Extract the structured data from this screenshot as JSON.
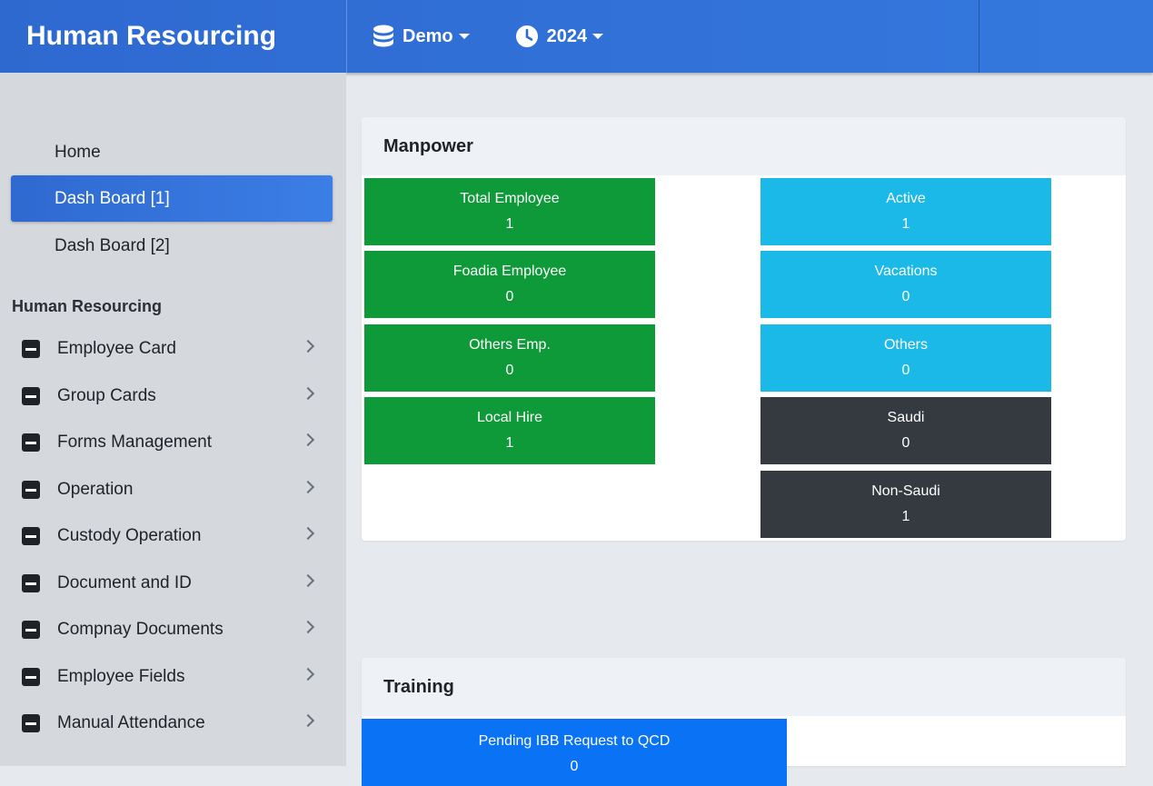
{
  "header": {
    "title": "Human Resourcing",
    "database_label": "Demo",
    "year_label": "2024"
  },
  "sidebar": {
    "top_items": [
      {
        "label": "Home",
        "active": false
      },
      {
        "label": "Dash Board [1]",
        "active": true
      },
      {
        "label": "Dash Board [2]",
        "active": false
      }
    ],
    "section_heading": "Human Resourcing",
    "items": [
      {
        "label": "Employee Card"
      },
      {
        "label": "Group Cards"
      },
      {
        "label": "Forms Management"
      },
      {
        "label": "Operation"
      },
      {
        "label": "Custody Operation"
      },
      {
        "label": "Document and ID"
      },
      {
        "label": "Compnay Documents"
      },
      {
        "label": "Employee Fields"
      },
      {
        "label": "Manual Attendance"
      }
    ]
  },
  "manpower": {
    "title": "Manpower",
    "left_tiles": [
      {
        "label": "Total Employee",
        "value": "1",
        "color": "#0f9a3a"
      },
      {
        "label": "Foadia Employee",
        "value": "0",
        "color": "#0f9a3a"
      },
      {
        "label": "Others Emp.",
        "value": "0",
        "color": "#0f9a3a"
      },
      {
        "label": "Local Hire",
        "value": "1",
        "color": "#0f9a3a"
      }
    ],
    "right_tiles": [
      {
        "label": "Active",
        "value": "1",
        "color": "#1bb9e8"
      },
      {
        "label": "Vacations",
        "value": "0",
        "color": "#1bb9e8"
      },
      {
        "label": "Others",
        "value": "0",
        "color": "#1bb9e8"
      },
      {
        "label": "Saudi",
        "value": "0",
        "color": "#343a40"
      },
      {
        "label": "Non-Saudi",
        "value": "1",
        "color": "#343a40"
      }
    ]
  },
  "training": {
    "title": "Training",
    "tiles": [
      {
        "label": "Pending IBB Request to QCD",
        "value": "0",
        "color": "#0a72f5"
      }
    ]
  }
}
